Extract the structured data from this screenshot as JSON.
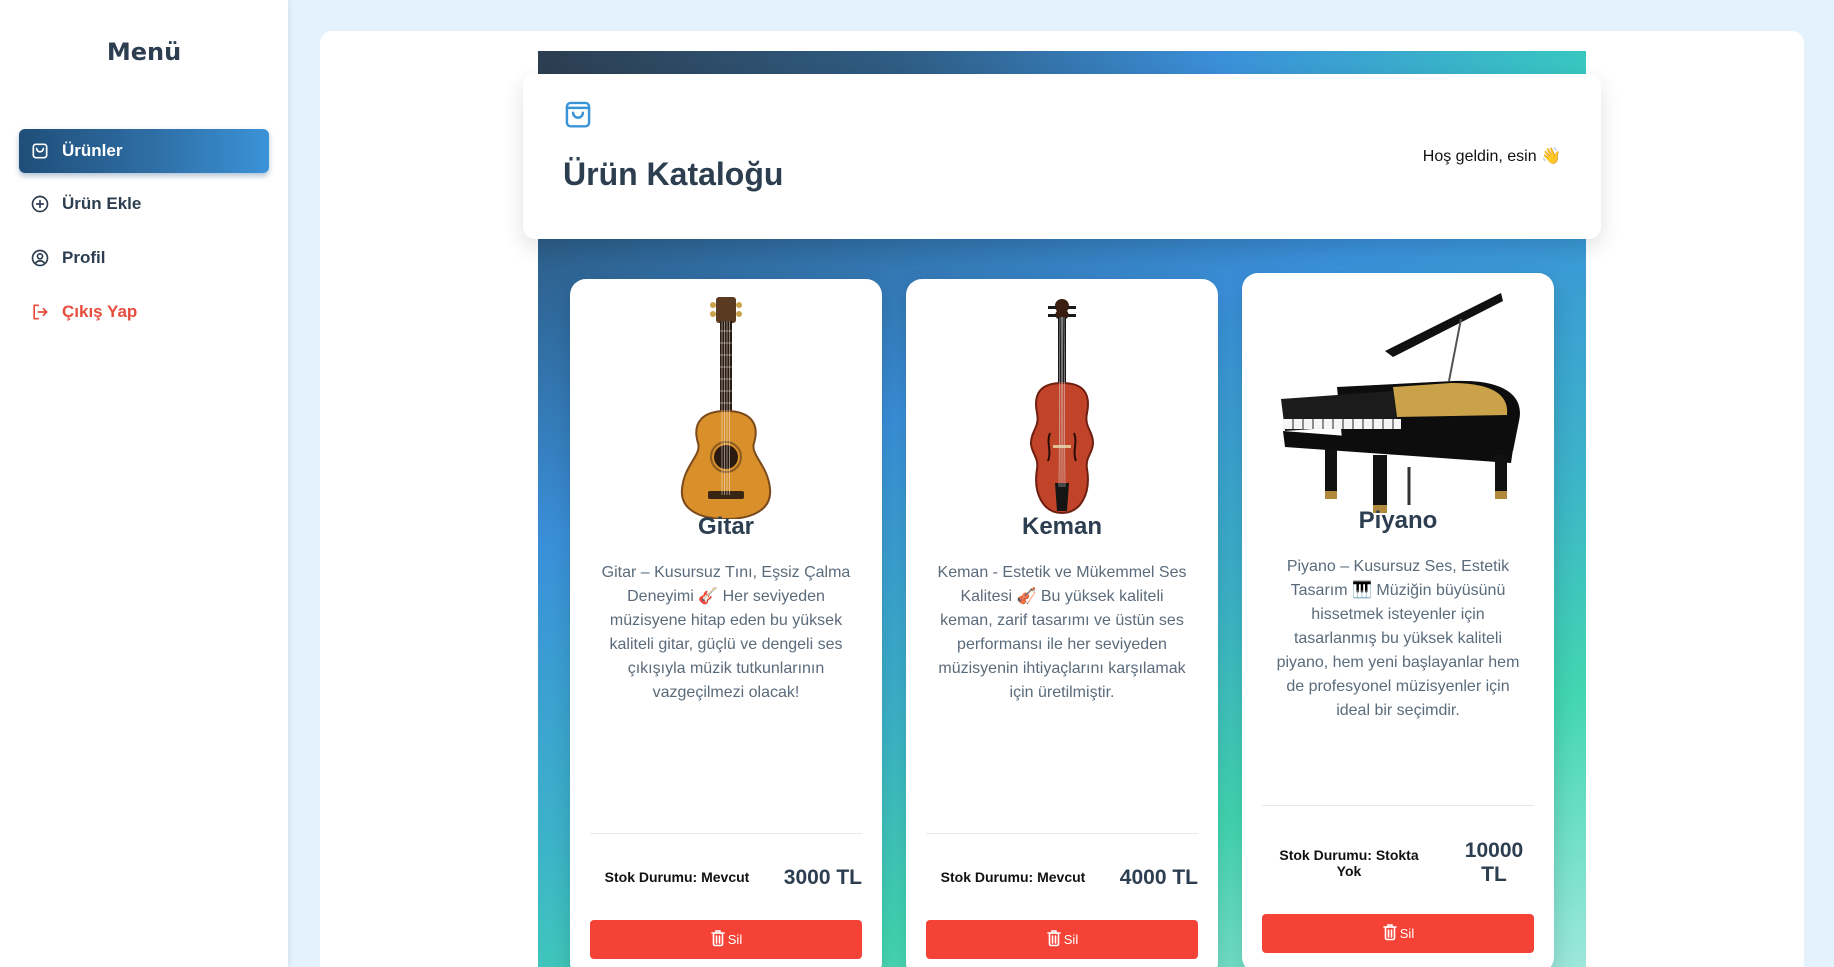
{
  "sidebar": {
    "title": "Menü",
    "items": [
      {
        "label": "Ürünler",
        "icon": "shopping-bag-icon",
        "active": true
      },
      {
        "label": "Ürün Ekle",
        "icon": "plus-circle-icon",
        "active": false
      },
      {
        "label": "Profil",
        "icon": "user-circle-icon",
        "active": false
      },
      {
        "label": "Çıkış Yap",
        "icon": "logout-icon",
        "active": false
      }
    ]
  },
  "header": {
    "title": "Ürün Kataloğu",
    "welcome": "Hoş geldin, esin 👋",
    "icon": "shopping-bag-icon"
  },
  "products": [
    {
      "name": "Gitar",
      "description": "Gitar – Kusursuz Tını, Eşsiz Çalma Deneyimi 🎸 Her seviyeden müzisyene hitap eden bu yüksek kaliteli gitar, güçlü ve dengeli ses çıkışıyla müzik tutkunlarının vazgeçilmezi olacak!",
      "stock": "Stok Durumu: Mevcut",
      "price": "3000 TL",
      "delete_label": "Sil"
    },
    {
      "name": "Keman",
      "description": "Keman - Estetik ve Mükemmel Ses Kalitesi 🎻 Bu yüksek kaliteli keman, zarif tasarımı ve üstün ses performansı ile her seviyeden müzisyenin ihtiyaçlarını karşılamak için üretilmiştir.",
      "stock": "Stok Durumu: Mevcut",
      "price": "4000 TL",
      "delete_label": "Sil"
    },
    {
      "name": "Piyano",
      "description": "Piyano – Kusursuz Ses, Estetik Tasarım 🎹 Müziğin büyüsünü hissetmek isteyenler için tasarlanmış bu yüksek kaliteli piyano, hem yeni başlayanlar hem de profesyonel müzisyenler için ideal bir seçimdir.",
      "stock": "Stok Durumu: Stokta Yok",
      "price": "10000 TL",
      "delete_label": "Sil"
    }
  ],
  "colors": {
    "accent": "#3b93d8",
    "text_dark": "#2c3e50",
    "danger": "#f44336",
    "logout": "#e74c3c"
  }
}
